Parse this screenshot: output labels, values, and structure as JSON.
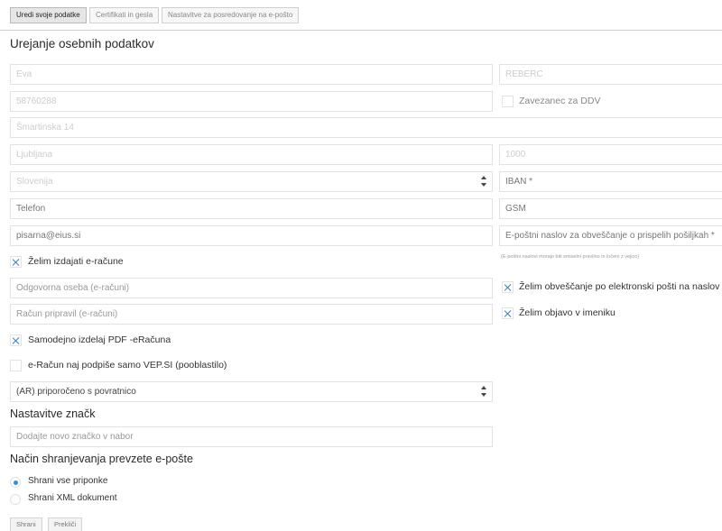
{
  "tabs": [
    "Uredi svoje podatke",
    "Certifikati in gesla",
    "Nastavitve za posredovanje na e-pošto"
  ],
  "section_title": "Urejanje osebnih podatkov",
  "fields": {
    "first_name": "Eva",
    "last_name": "REBERC",
    "tax_number": "58760288",
    "vat_payer_label": "Zavezanec za DDV",
    "street": "Šmartinska 14",
    "city": "Ljubljana",
    "postal_code": "1000",
    "country": "Slovenija",
    "iban_placeholder": "IBAN *",
    "phone_placeholder": "Telefon",
    "gsm_placeholder": "GSM",
    "email": "pisarna@eius.si",
    "notify_email_placeholder": "E-poštni naslov za obveščanje o prispelih pošiljkah *",
    "notify_email_hint": "(E-poštni naslovi morajo biti smiselni pravilno in ločeni z vejico)",
    "contact_person_placeholder": "Odgovorna oseba (e-računi)",
    "prepared_by_placeholder": "Račun pripravil (e-računi)",
    "delivery_method": "(AR) priporočeno s povratnico"
  },
  "checkboxes": {
    "issue_einvoices": "Želim izdajati e-račune",
    "email_notify": "Želim obveščanje po elektronski pošti na naslov",
    "directory": "Želim objavo v imeniku",
    "auto_pdf": "Samodejno izdelaj PDF -eRačuna",
    "vep_sign": "e-Račun naj podpiše samo VEP.SI (pooblastilo)"
  },
  "tags": {
    "title": "Nastavitve značk",
    "placeholder": "Dodajte novo značko v nabor"
  },
  "storage": {
    "title": "Način shranjevanja prevzete e-pošte",
    "options": [
      "Shrani vse priponke",
      "Shrani XML dokument"
    ],
    "selected": "Shrani vse priponke"
  },
  "buttons": {
    "save": "Shrani",
    "cancel": "Prekliči"
  },
  "colors": {
    "accent": "#2f7fd1",
    "border": "#e2e2e2"
  }
}
